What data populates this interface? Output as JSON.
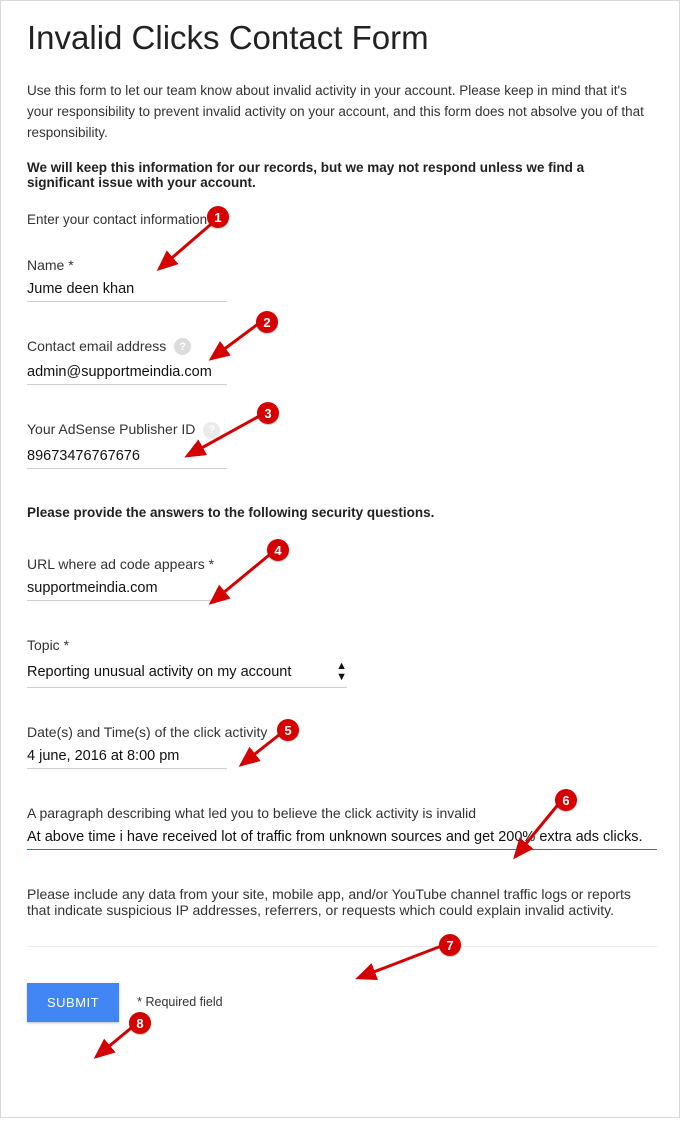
{
  "title": "Invalid Clicks Contact Form",
  "intro": "Use this form to let our team know about invalid activity in your account. Please keep in mind that it's your responsibility to prevent invalid activity on your account, and this form does not absolve you of that responsibility.",
  "keep_notice": "We will keep this information for our records, but we may not respond unless we find a significant issue with your account.",
  "contact_heading": "Enter your contact information",
  "fields": {
    "name": {
      "label": "Name *",
      "value": "Jume deen khan"
    },
    "email": {
      "label": "Contact email address",
      "value": "admin@supportmeindia.com"
    },
    "pubid": {
      "label": "Your AdSense Publisher ID",
      "value": "89673476767676"
    },
    "url": {
      "label": "URL where ad code appears *",
      "value": "supportmeindia.com"
    },
    "topic": {
      "label": "Topic *",
      "value": "Reporting unusual activity on my account"
    },
    "dates": {
      "label": "Date(s) and Time(s) of the click activity",
      "value": "4 june, 2016 at 8:00 pm"
    },
    "paragraph": {
      "label": "A paragraph describing what led you to believe the click activity is invalid",
      "value": "At above time i have received lot of traffic from unknown sources and get 200% extra ads clicks."
    },
    "logs": {
      "label": "Please include any data from your site, mobile app, and/or YouTube channel traffic logs or reports that indicate suspicious IP addresses, referrers, or requests which could explain invalid activity.",
      "value": ""
    }
  },
  "security_heading": "Please provide the answers to the following security questions.",
  "submit_label": "SUBMIT",
  "required_note": "* Required field",
  "help_badge": "?",
  "annotations": {
    "1": "1",
    "2": "2",
    "3": "3",
    "4": "4",
    "5": "5",
    "6": "6",
    "7": "7",
    "8": "8"
  }
}
